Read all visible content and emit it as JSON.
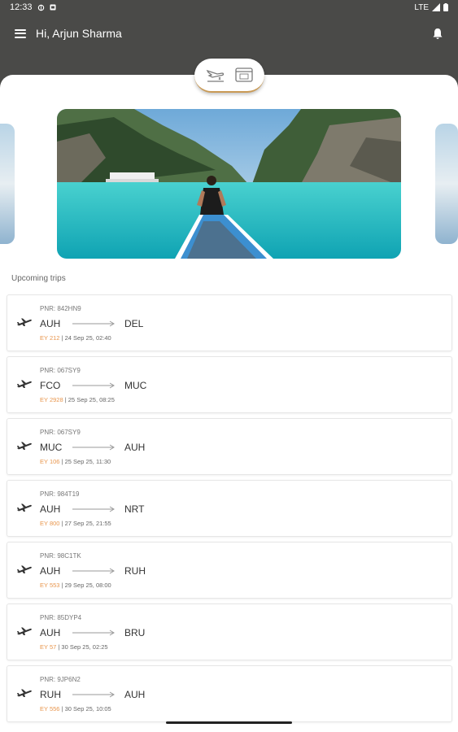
{
  "status": {
    "time": "12:33",
    "network": "LTE"
  },
  "header": {
    "greeting": "Hi, Arjun  Sharma"
  },
  "section": {
    "title": "Upcoming trips"
  },
  "trips": [
    {
      "pnr": "PNR: 842HN9",
      "from": "AUH",
      "to": "DEL",
      "flight": "EY 212",
      "sep": " | ",
      "date": "24 Sep 25, 02:40"
    },
    {
      "pnr": "PNR: 067SY9",
      "from": "FCO",
      "to": "MUC",
      "flight": "EY 2928",
      "sep": " | ",
      "date": "25 Sep 25, 08:25"
    },
    {
      "pnr": "PNR: 067SY9",
      "from": "MUC",
      "to": "AUH",
      "flight": "EY 106",
      "sep": " | ",
      "date": "25 Sep 25, 11:30"
    },
    {
      "pnr": "PNR: 984T19",
      "from": "AUH",
      "to": "NRT",
      "flight": "EY 800",
      "sep": " | ",
      "date": "27 Sep 25, 21:55"
    },
    {
      "pnr": "PNR: 98C1TK",
      "from": "AUH",
      "to": "RUH",
      "flight": "EY 553",
      "sep": " | ",
      "date": "29 Sep 25, 08:00"
    },
    {
      "pnr": "PNR: 85DYP4",
      "from": "AUH",
      "to": "BRU",
      "flight": "EY 57",
      "sep": " | ",
      "date": "30 Sep 25, 02:25"
    },
    {
      "pnr": "PNR: 9JP6N2",
      "from": "RUH",
      "to": "AUH",
      "flight": "EY 556",
      "sep": " | ",
      "date": "30 Sep 25, 10:05"
    }
  ],
  "icons": {
    "menu": "menu-icon",
    "bell": "bell-icon",
    "plane": "plane-icon",
    "flight_toggle": "flight-land-icon",
    "calendar_toggle": "calendar-icon"
  },
  "colors": {
    "header_bg": "#4a4a48",
    "accent": "#c99a55",
    "flight_number": "#e8964d",
    "sea": "#2fc2c4"
  }
}
